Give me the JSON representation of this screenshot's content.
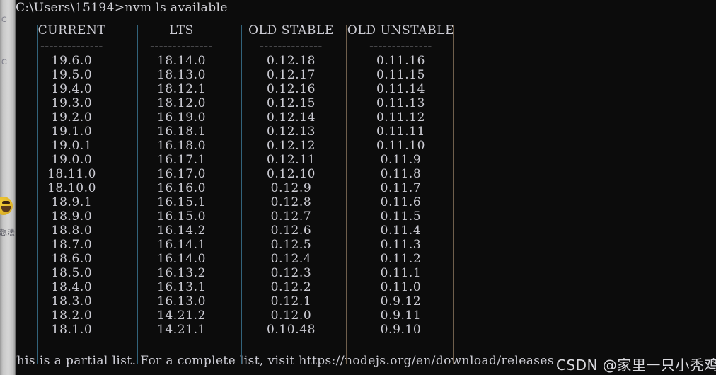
{
  "background_window": {
    "ghost_labels": [
      "C",
      "C"
    ],
    "ghost_cjk": "想法",
    "avatar_name": "user-avatar"
  },
  "console": {
    "prompt_line": "C:\\Users\\15194>nvm ls available",
    "footer": "This is a partial list. For a complete list, visit https://nodejs.org/en/download/releases",
    "colors": {
      "background": "#0c0c0c",
      "text": "#ccccd4",
      "rule": "#3c6e86"
    }
  },
  "watermark": {
    "text": "CSDN @家里一只小秃鸡"
  },
  "table": {
    "headers": [
      "CURRENT",
      "LTS",
      "OLD STABLE",
      "OLD UNSTABLE"
    ],
    "separator": "--------------",
    "rows": [
      [
        "19.6.0",
        "18.14.0",
        "0.12.18",
        "0.11.16"
      ],
      [
        "19.5.0",
        "18.13.0",
        "0.12.17",
        "0.11.15"
      ],
      [
        "19.4.0",
        "18.12.1",
        "0.12.16",
        "0.11.14"
      ],
      [
        "19.3.0",
        "18.12.0",
        "0.12.15",
        "0.11.13"
      ],
      [
        "19.2.0",
        "16.19.0",
        "0.12.14",
        "0.11.12"
      ],
      [
        "19.1.0",
        "16.18.1",
        "0.12.13",
        "0.11.11"
      ],
      [
        "19.0.1",
        "16.18.0",
        "0.12.12",
        "0.11.10"
      ],
      [
        "19.0.0",
        "16.17.1",
        "0.12.11",
        "0.11.9"
      ],
      [
        "18.11.0",
        "16.17.0",
        "0.12.10",
        "0.11.8"
      ],
      [
        "18.10.0",
        "16.16.0",
        "0.12.9",
        "0.11.7"
      ],
      [
        "18.9.1",
        "16.15.1",
        "0.12.8",
        "0.11.6"
      ],
      [
        "18.9.0",
        "16.15.0",
        "0.12.7",
        "0.11.5"
      ],
      [
        "18.8.0",
        "16.14.2",
        "0.12.6",
        "0.11.4"
      ],
      [
        "18.7.0",
        "16.14.1",
        "0.12.5",
        "0.11.3"
      ],
      [
        "18.6.0",
        "16.14.0",
        "0.12.4",
        "0.11.2"
      ],
      [
        "18.5.0",
        "16.13.2",
        "0.12.3",
        "0.11.1"
      ],
      [
        "18.4.0",
        "16.13.1",
        "0.12.2",
        "0.11.0"
      ],
      [
        "18.3.0",
        "16.13.0",
        "0.12.1",
        "0.9.12"
      ],
      [
        "18.2.0",
        "14.21.2",
        "0.12.0",
        "0.9.11"
      ],
      [
        "18.1.0",
        "14.21.1",
        "0.10.48",
        "0.9.10"
      ]
    ]
  }
}
